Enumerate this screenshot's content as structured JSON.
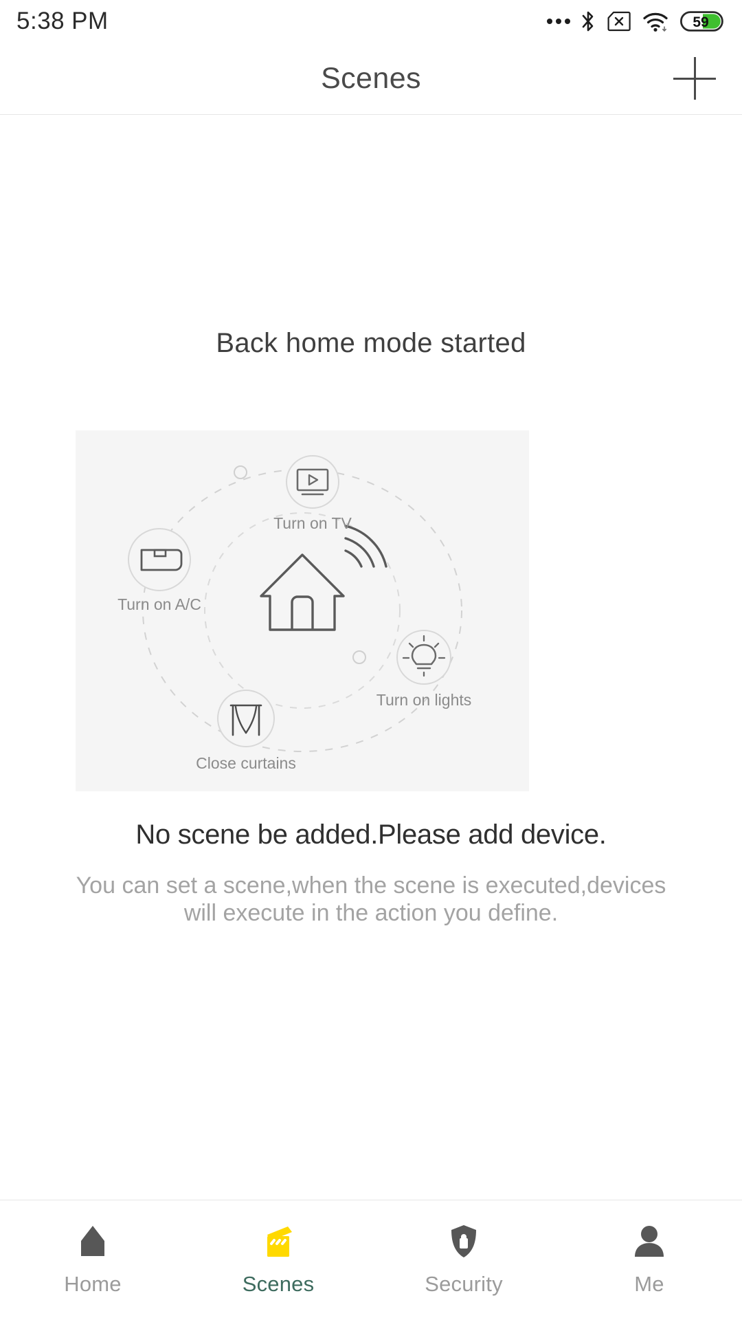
{
  "status_bar": {
    "time": "5:38",
    "ampm": "PM",
    "battery_percent": "59",
    "icons": [
      "more-dots-icon",
      "bluetooth-icon",
      "sim-card-off-icon",
      "wifi-icon",
      "battery-icon"
    ]
  },
  "header": {
    "title": "Scenes",
    "add_button": "add-scene-button"
  },
  "content": {
    "headline": "Back home mode started",
    "empty_title": "No scene be added.Please add device.",
    "empty_desc": "You can set a scene,when the scene is executed,devices will execute in the action you define."
  },
  "illustration": {
    "center_icon": "smart-home-icon",
    "nodes": [
      {
        "id": "tv",
        "icon": "tv-play-icon",
        "label": "Turn on TV"
      },
      {
        "id": "ac",
        "icon": "ac-unit-icon",
        "label": "Turn on A/C"
      },
      {
        "id": "lights",
        "icon": "light-bulb-icon",
        "label": "Turn on lights"
      },
      {
        "id": "curtains",
        "icon": "curtains-icon",
        "label": "Close curtains"
      }
    ]
  },
  "tabbar": {
    "active": "Scenes",
    "items": [
      {
        "label": "Home",
        "icon": "home-icon",
        "active": false
      },
      {
        "label": "Scenes",
        "icon": "clapper-icon",
        "active": true
      },
      {
        "label": "Security",
        "icon": "shield-lock-icon",
        "active": false
      },
      {
        "label": "Me",
        "icon": "person-icon",
        "active": false
      }
    ]
  },
  "colors": {
    "accent_yellow": "#FFD900",
    "active_label": "#3d6b5e",
    "battery_green": "#3fbf2f",
    "panel_bg": "#f5f5f5"
  }
}
